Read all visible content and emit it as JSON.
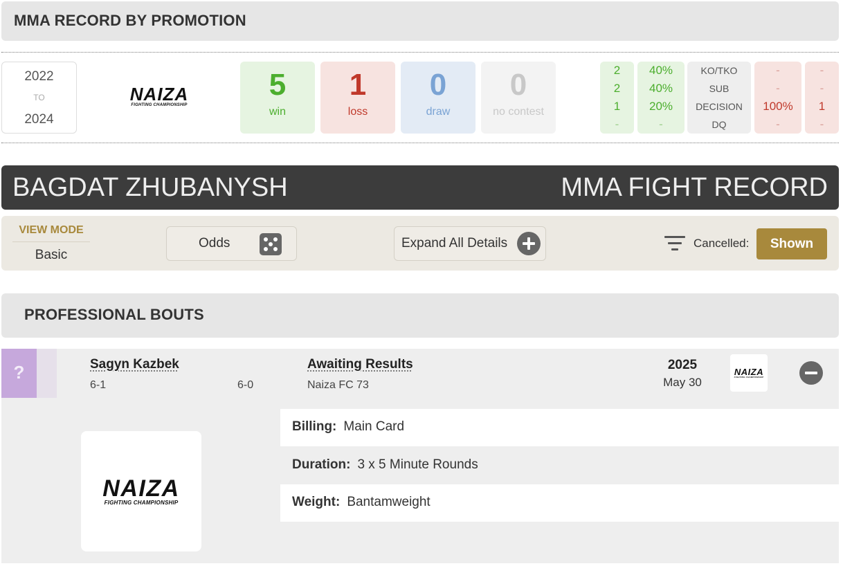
{
  "promotion_record": {
    "header": "MMA RECORD BY PROMOTION",
    "years": {
      "start": "2022",
      "to": "TO",
      "end": "2024"
    },
    "promotion_logo": {
      "name": "NAIZA",
      "subtitle": "FIGHTING CHAMPIONSHIP"
    },
    "totals": {
      "win": {
        "value": "5",
        "label": "win"
      },
      "loss": {
        "value": "1",
        "label": "loss"
      },
      "draw": {
        "value": "0",
        "label": "draw"
      },
      "no_contest": {
        "value": "0",
        "label": "no contest"
      }
    },
    "methods": [
      "KO/TKO",
      "SUB",
      "DECISION",
      "DQ"
    ],
    "wins_by_method": [
      "2",
      "2",
      "1",
      "-"
    ],
    "win_pct_by_method": [
      "40%",
      "40%",
      "20%",
      "-"
    ],
    "loss_pct_by_method": [
      "-",
      "-",
      "100%",
      "-"
    ],
    "losses_by_method": [
      "-",
      "-",
      "1",
      "-"
    ]
  },
  "fighter_bar": {
    "name": "BAGDAT ZHUBANYSH",
    "title": "MMA FIGHT RECORD"
  },
  "mode_bar": {
    "view_mode_label": "VIEW MODE",
    "view_mode_value": "Basic",
    "odds_label": "Odds",
    "expand_label": "Expand All Details",
    "cancelled_label": "Cancelled:",
    "cancelled_value": "Shown"
  },
  "bouts": {
    "header": "PROFESSIONAL BOUTS",
    "items": [
      {
        "result_badge": "?",
        "opponent_name": "Sagyn Kazbek",
        "opponent_record": "6-1",
        "fighter_record": "6-0",
        "result": "Awaiting Results",
        "event": "Naiza FC 73",
        "year": "2025",
        "date": "May 30",
        "promotion_logo": {
          "name": "NAIZA",
          "subtitle": "FIGHTING CHAMPIONSHIP"
        },
        "details": {
          "billing_label": "Billing:",
          "billing_value": "Main Card",
          "duration_label": "Duration:",
          "duration_value": "3 x 5 Minute Rounds",
          "weight_label": "Weight:",
          "weight_value": "Bantamweight"
        }
      }
    ]
  },
  "colors": {
    "win": "#4cae2e",
    "loss": "#c0392b",
    "draw": "#7aa3d4",
    "no_contest": "#c8c8c8",
    "accent_gold": "#a8893c",
    "title_bar": "#3c3c3c",
    "pending_badge": "#c6a8dc"
  },
  "icons": {
    "odds": "dice-icon",
    "expand": "plus-circle-icon",
    "filter": "filter-icon",
    "collapse": "minus-circle-icon"
  }
}
